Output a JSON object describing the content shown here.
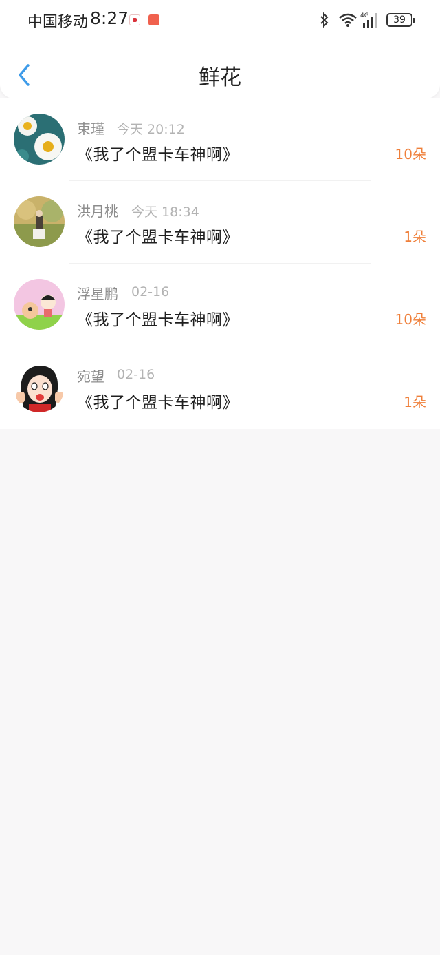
{
  "status_bar": {
    "carrier": "中国移动",
    "time": "8:27",
    "battery": "39",
    "network": "4G"
  },
  "header": {
    "title": "鲜花",
    "back_icon": "chevron-left-icon",
    "accent_color": "#3d9be9"
  },
  "items": [
    {
      "name": "束瑾",
      "time": "今天 20:12",
      "book": "《我了个盟卡车神啊》",
      "count": "10朵"
    },
    {
      "name": "洪月桃",
      "time": "今天 18:34",
      "book": "《我了个盟卡车神啊》",
      "count": "1朵"
    },
    {
      "name": "浮星鹏",
      "time": "02-16",
      "book": "《我了个盟卡车神啊》",
      "count": "10朵"
    },
    {
      "name": "宛望",
      "time": "02-16",
      "book": "《我了个盟卡车神啊》",
      "count": "1朵"
    }
  ],
  "colors": {
    "count_color": "#ef7f3a",
    "background": "#f8f7f8"
  }
}
